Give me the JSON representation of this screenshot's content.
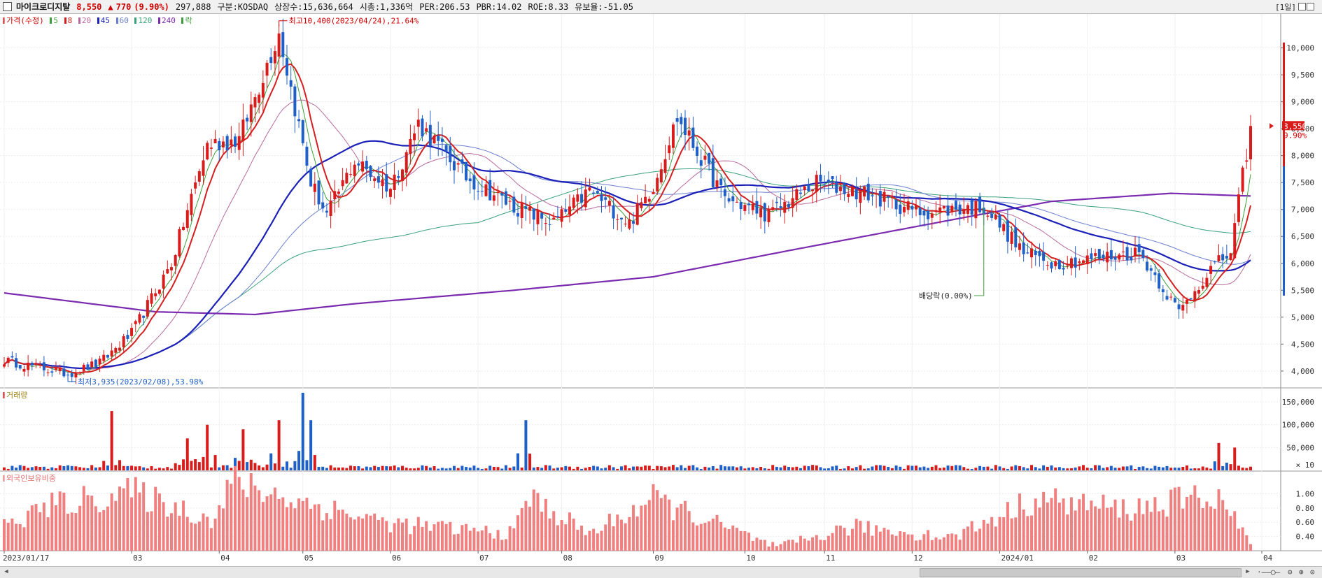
{
  "header": {
    "name": "마이크로디지탈",
    "price": "8,550",
    "arrow": "▲",
    "change": "770",
    "change_pct": "(9.90%)",
    "volume": "297,888",
    "market": "구분:KOSDAQ",
    "shares": "상장수:15,636,664",
    "market_cap": "시총:1,336억",
    "per": "PER:206.53",
    "pbr": "PBR:14.02",
    "roe": "ROE:8.33",
    "float_ratio": "유보율:-51.05",
    "period": "[1일]"
  },
  "legend": {
    "price": "가격(수정)",
    "ma": [
      "5",
      "8",
      "20",
      "45",
      "60",
      "120",
      "240"
    ],
    "drop": "락"
  },
  "colors": {
    "up": "#d81b1b",
    "down": "#1f5fc8",
    "ma5": "#3ca03c",
    "ma8": "#d42020",
    "ma20": "#b86a9e",
    "ma45": "#1a20b8",
    "ma60": "#6a7fd0",
    "ma120": "#3aa27a",
    "ma240": "#7a2bb0",
    "foreign": "#f08080"
  },
  "annotations": {
    "high": "최고10,400(2023/04/24),21.64%",
    "low": "최저3,935(2023/02/08),53.98%",
    "dividend": "배당락(0.00%)"
  },
  "panels": {
    "volume_title": "거래량",
    "foreign_title": "외국인보유비중",
    "volume_unit": "× 10"
  },
  "chart_data": [
    {
      "type": "candlestick",
      "title": "가격(수정)",
      "ylim": [
        3700,
        10500
      ],
      "y_ticks": [
        "10,000",
        "9,500",
        "9,000",
        "8,500",
        "8,000",
        "7,500",
        "7,000",
        "6,500",
        "6,000",
        "5,500",
        "5,000",
        "4,500",
        "4,000"
      ],
      "x_ticks": [
        "2023/01/17",
        "03",
        "04",
        "05",
        "06",
        "07",
        "08",
        "09",
        "10",
        "11",
        "12",
        "2024/01",
        "02",
        "03",
        "04"
      ],
      "last_price": "8,550",
      "last_change": "9.90%",
      "anchors": [
        [
          "2023-01-17",
          4200
        ],
        [
          "2023-02-08",
          3950
        ],
        [
          "2023-02-20",
          4150
        ],
        [
          "2023-03-02",
          4700
        ],
        [
          "2023-03-16",
          6000
        ],
        [
          "2023-03-29",
          8200
        ],
        [
          "2023-04-10",
          8300
        ],
        [
          "2023-04-24",
          10300
        ],
        [
          "2023-05-04",
          7500
        ],
        [
          "2023-05-10",
          6900
        ],
        [
          "2023-05-19",
          7900
        ],
        [
          "2023-06-01",
          7400
        ],
        [
          "2023-06-12",
          8600
        ],
        [
          "2023-06-28",
          7600
        ],
        [
          "2023-07-14",
          7050
        ],
        [
          "2023-07-28",
          6750
        ],
        [
          "2023-08-10",
          7350
        ],
        [
          "2023-08-24",
          6750
        ],
        [
          "2023-09-01",
          7450
        ],
        [
          "2023-09-11",
          8700
        ],
        [
          "2023-09-27",
          7200
        ],
        [
          "2023-10-12",
          6900
        ],
        [
          "2023-10-30",
          7500
        ],
        [
          "2023-11-15",
          7300
        ],
        [
          "2023-12-05",
          6950
        ],
        [
          "2023-12-27",
          7050
        ],
        [
          "2024-01-10",
          6200
        ],
        [
          "2024-01-22",
          6000
        ],
        [
          "2024-02-05",
          6100
        ],
        [
          "2024-02-20",
          6200
        ],
        [
          "2024-03-05",
          5100
        ],
        [
          "2024-03-15",
          5900
        ],
        [
          "2024-03-22",
          6200
        ],
        [
          "2024-03-29",
          8550
        ]
      ],
      "ma240_anchors": [
        [
          "2023-01-17",
          5450
        ],
        [
          "2023-03-10",
          5100
        ],
        [
          "2023-04-15",
          5050
        ],
        [
          "2023-05-20",
          5250
        ],
        [
          "2023-07-15",
          5500
        ],
        [
          "2023-09-01",
          5750
        ],
        [
          "2023-10-20",
          6250
        ],
        [
          "2023-12-20",
          6850
        ],
        [
          "2024-01-20",
          7150
        ],
        [
          "2024-03-01",
          7300
        ],
        [
          "2024-03-29",
          7250
        ]
      ]
    },
    {
      "type": "bar",
      "title": "거래량",
      "ylim": [
        0,
        170000
      ],
      "y_ticks": [
        "150,000",
        "100,000",
        "50,000"
      ],
      "unit": "× 10",
      "peaks": [
        [
          "2023-02-23",
          130000
        ],
        [
          "2023-03-22",
          70000
        ],
        [
          "2023-03-29",
          100000
        ],
        [
          "2023-04-11",
          90000
        ],
        [
          "2023-04-24",
          110000
        ],
        [
          "2023-05-02",
          170000
        ],
        [
          "2023-05-04",
          110000
        ],
        [
          "2023-07-19",
          110000
        ],
        [
          "2024-03-19",
          60000
        ],
        [
          "2024-03-25",
          50000
        ]
      ]
    },
    {
      "type": "bar",
      "title": "외국인보유비중",
      "ylim": [
        0.2,
        1.25
      ],
      "y_ticks": [
        "1.00",
        "0.80",
        "0.60",
        "0.40"
      ],
      "peaks": [
        [
          "2023-01-17",
          0.55
        ],
        [
          "2023-02-01",
          0.85
        ],
        [
          "2023-03-02",
          1.05
        ],
        [
          "2023-04-01",
          0.65
        ],
        [
          "2023-04-06",
          1.2
        ],
        [
          "2023-05-02",
          0.9
        ],
        [
          "2023-06-01",
          0.6
        ],
        [
          "2023-07-14",
          0.45
        ],
        [
          "2023-07-19",
          1.0
        ],
        [
          "2023-08-10",
          0.45
        ],
        [
          "2023-09-01",
          0.95
        ],
        [
          "2023-10-15",
          0.25
        ],
        [
          "2023-11-10",
          0.55
        ],
        [
          "2023-12-15",
          0.4
        ],
        [
          "2024-01-15",
          0.95
        ],
        [
          "2024-02-15",
          0.8
        ],
        [
          "2024-03-08",
          0.95
        ],
        [
          "2024-03-19",
          1.0
        ],
        [
          "2024-03-29",
          0.3
        ]
      ]
    }
  ]
}
